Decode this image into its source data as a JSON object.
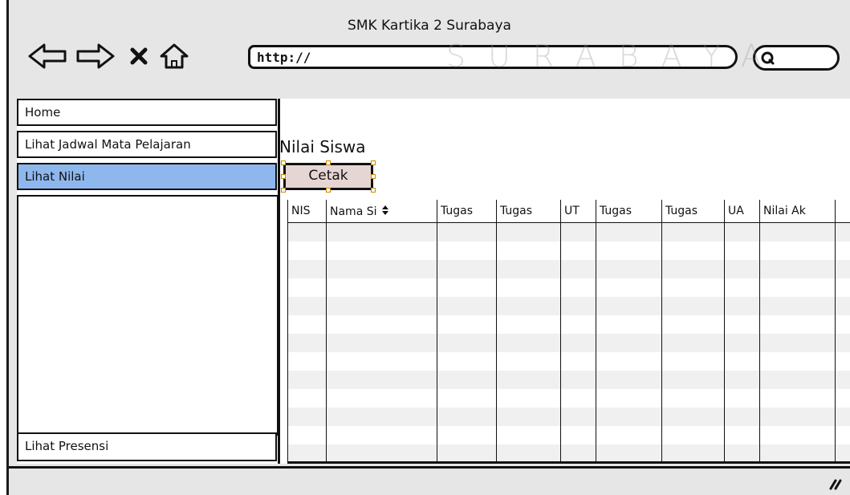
{
  "window": {
    "title": "SMK Kartika 2 Surabaya"
  },
  "toolbar": {
    "back_icon": "back-arrow-icon",
    "forward_icon": "forward-arrow-icon",
    "stop_icon": "close-icon",
    "home_icon": "home-icon",
    "url_value": "http://",
    "search_icon": "search-icon"
  },
  "watermark": {
    "text": "SURABAYA"
  },
  "sidebar": {
    "items": [
      {
        "label": "Home"
      },
      {
        "label": "Lihat Jadwal Mata Pelajaran"
      },
      {
        "label": "Lihat Nilai"
      },
      {
        "label": "Lihat Presensi"
      }
    ],
    "selected_index": 2
  },
  "main": {
    "title": "Nilai Siswa",
    "print_button": "Cetak"
  },
  "table": {
    "columns": [
      "NIS",
      "Nama Si",
      "Tugas",
      "Tugas",
      "UT",
      "Tugas",
      "Tugas",
      "UA",
      "Nilai Ak",
      ""
    ],
    "sort_icon": "sort-updown-icon",
    "rows": []
  },
  "colors": {
    "selected_bg": "#8eb7ee",
    "button_bg": "#e6d6d3",
    "chrome_bg": "#e6e6e6"
  }
}
